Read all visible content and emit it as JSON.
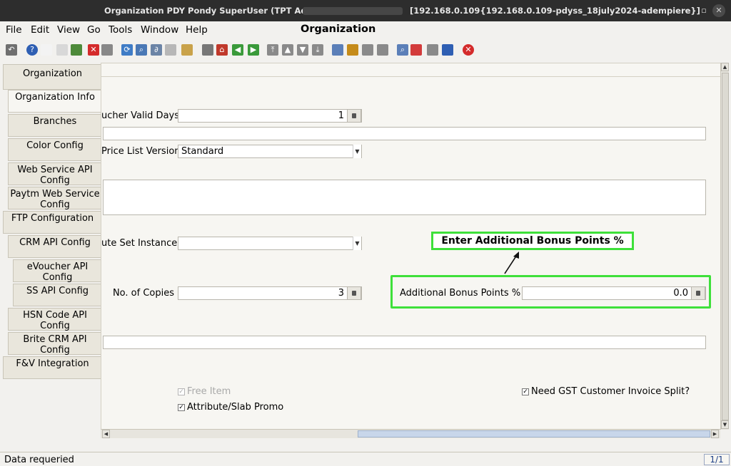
{
  "titlebar": {
    "left_text": "Organization  PDY  Pondy  SuperUser (TPT Admin) @",
    "right_text": "[192.168.0.109{192.168.0.109-pdyss_18july2024-adempiere}]",
    "minimize": "–",
    "maximize": "▫",
    "close": "✕"
  },
  "menu": {
    "file": "File",
    "edit": "Edit",
    "view": "View",
    "go": "Go",
    "tools": "Tools",
    "window": "Window",
    "help": "Help"
  },
  "window_title": "Organization",
  "toolbar_icons": [
    {
      "name": "undo-icon",
      "glyph": "↶",
      "color": "#6f6f6f"
    },
    {
      "name": "help-icon",
      "glyph": "?",
      "color": "#2f5fb3"
    },
    {
      "name": "new-record-icon",
      "glyph": "",
      "color": "#f3f3f3"
    },
    {
      "name": "copy-record-icon",
      "glyph": "",
      "color": "#d8d8d8"
    },
    {
      "name": "save-record-icon",
      "glyph": "",
      "color": "#4d8a3a"
    },
    {
      "name": "delete-icon",
      "glyph": "✕",
      "color": "#d42b2b"
    },
    {
      "name": "print-preview-icon",
      "glyph": "",
      "color": "#888888"
    },
    {
      "name": "refresh-icon",
      "glyph": "⟳",
      "color": "#3f7cc6"
    },
    {
      "name": "find-icon",
      "glyph": "⌕",
      "color": "#4a78b5"
    },
    {
      "name": "attachment-icon",
      "glyph": "∂",
      "color": "#6b84a6"
    },
    {
      "name": "chat-icon",
      "glyph": "",
      "color": "#b7b7b7"
    },
    {
      "name": "grid-toggle-icon",
      "glyph": "",
      "color": "#c9a24a"
    },
    {
      "name": "history-icon",
      "glyph": "",
      "color": "#777777"
    },
    {
      "name": "home-icon",
      "glyph": "⌂",
      "color": "#c0392b"
    },
    {
      "name": "parent-icon",
      "glyph": "◀",
      "color": "#3a9a3a"
    },
    {
      "name": "detail-icon",
      "glyph": "▶",
      "color": "#3a9a3a"
    },
    {
      "name": "first-record-icon",
      "glyph": "⤒",
      "color": "#8a8a8a"
    },
    {
      "name": "previous-record-icon",
      "glyph": "▲",
      "color": "#8a8a8a"
    },
    {
      "name": "next-record-icon",
      "glyph": "▼",
      "color": "#8a8a8a"
    },
    {
      "name": "last-record-icon",
      "glyph": "⤓",
      "color": "#8a8a8a"
    },
    {
      "name": "report-icon",
      "glyph": "",
      "color": "#5b7fb8"
    },
    {
      "name": "archived-icon",
      "glyph": "",
      "color": "#c58b1a"
    },
    {
      "name": "print-icon",
      "glyph": "",
      "color": "#8a8a8a"
    },
    {
      "name": "print-alt-icon",
      "glyph": "",
      "color": "#8a8a8a"
    },
    {
      "name": "zoom-across-icon",
      "glyph": "⌕",
      "color": "#5b7fb8"
    },
    {
      "name": "workflow-icon",
      "glyph": "",
      "color": "#d33b3b"
    },
    {
      "name": "request-icon",
      "glyph": "",
      "color": "#8a8a8a"
    },
    {
      "name": "product-info-icon",
      "glyph": "",
      "color": "#2f5fb3"
    },
    {
      "name": "exit-icon",
      "glyph": "✕",
      "color": "#d42b2b"
    }
  ],
  "tabs": [
    {
      "label": "Organization"
    },
    {
      "label": "Organization Info"
    },
    {
      "label": "Branches"
    },
    {
      "label": "Color Config"
    },
    {
      "label": "Web Service API Config"
    },
    {
      "label": "Paytm Web Service Config"
    },
    {
      "label": "FTP Configuration"
    },
    {
      "label": "CRM API Config"
    },
    {
      "label": "eVoucher API Config"
    },
    {
      "label": "SS API Config"
    },
    {
      "label": "HSN Code API Config"
    },
    {
      "label": "Brite CRM API Config"
    },
    {
      "label": "F&V Integration"
    }
  ],
  "form": {
    "voucher_valid_days_label": "ucher Valid Days",
    "voucher_valid_days_value": "1",
    "price_list_version_label": "Price List Version",
    "price_list_version_value": "Standard",
    "attribute_set_instance_label": "ute Set Instance",
    "attribute_set_instance_value": "",
    "no_of_copies_label": "No. of Copies",
    "no_of_copies_value": "3",
    "additional_bonus_label": "Additional Bonus Points %",
    "additional_bonus_value": "0.0",
    "free_item_label": "Free Item",
    "attribute_slab_promo_label": "Attribute/Slab Promo",
    "gst_split_label": "Need GST Customer Invoice Split?"
  },
  "callout_text": "Enter Additional Bonus Points %",
  "status": {
    "message": "Data requeried",
    "record_count": "1/1"
  },
  "colors": {
    "highlight": "#3ee03a",
    "titlebar": "#2d2d2d"
  }
}
